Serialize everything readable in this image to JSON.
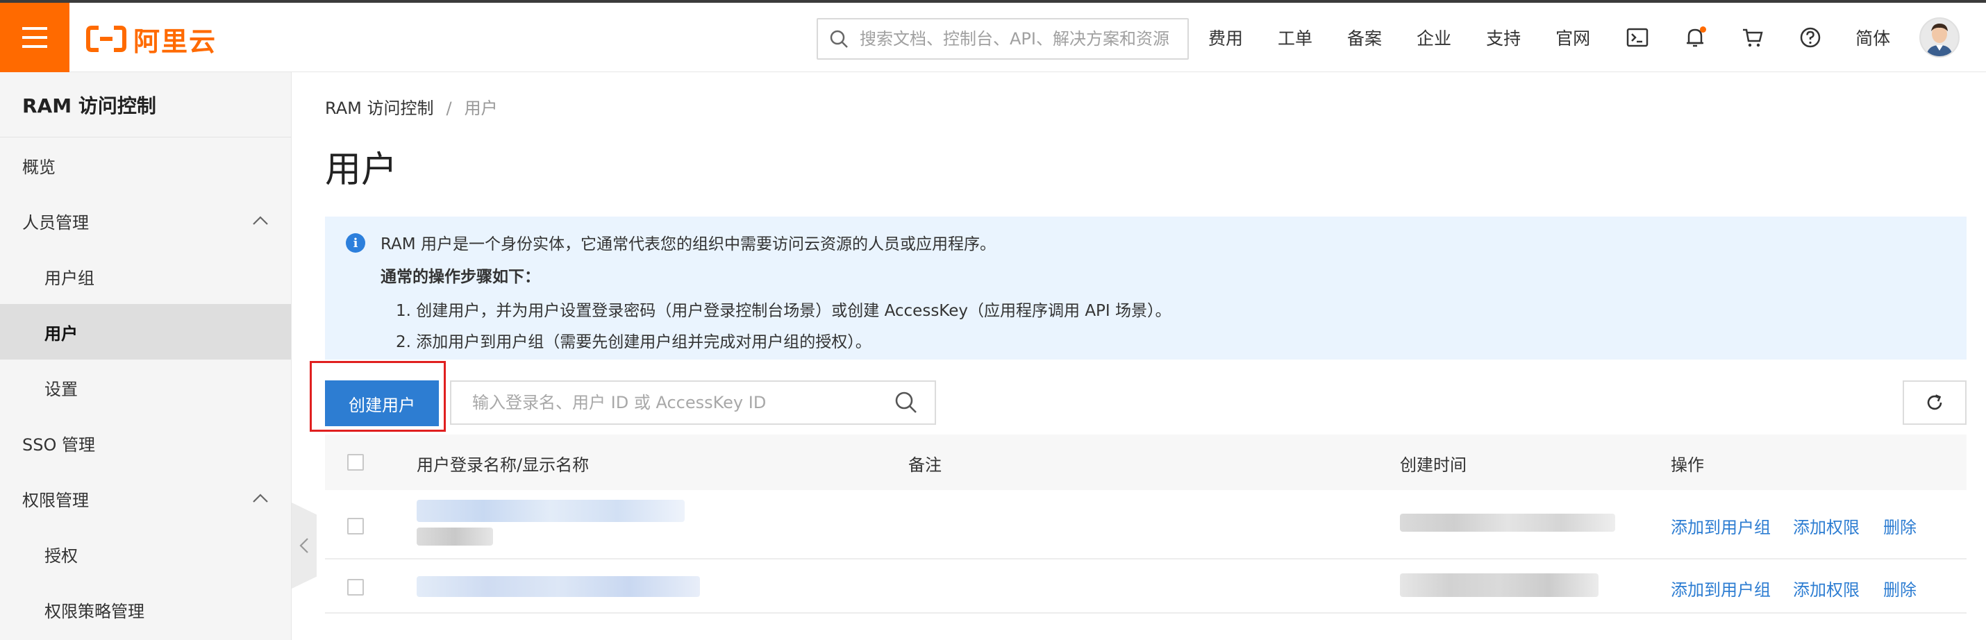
{
  "topbar": {
    "logo_text": "阿里云",
    "search_placeholder": "搜索文档、控制台、API、解决方案和资源",
    "nav": [
      "费用",
      "工单",
      "备案",
      "企业",
      "支持",
      "官网"
    ],
    "lang": "简体"
  },
  "sidebar": {
    "title": "RAM 访问控制",
    "items": [
      {
        "label": "概览"
      },
      {
        "label": "人员管理"
      },
      {
        "label": "用户组"
      },
      {
        "label": "用户"
      },
      {
        "label": "设置"
      },
      {
        "label": "SSO 管理"
      },
      {
        "label": "权限管理"
      },
      {
        "label": "授权"
      },
      {
        "label": "权限策略管理"
      }
    ]
  },
  "breadcrumb": {
    "root": "RAM 访问控制",
    "sep": "/",
    "current": "用户"
  },
  "page_title": "用户",
  "info": {
    "line1": "RAM 用户是一个身份实体，它通常代表您的组织中需要访问云资源的人员或应用程序。",
    "line2": "通常的操作步骤如下：",
    "line3": "1. 创建用户，并为用户设置登录密码（用户登录控制台场景）或创建 AccessKey（应用程序调用 API 场景）。",
    "line4": "2. 添加用户到用户组（需要先创建用户组并完成对用户组的授权）。"
  },
  "toolbar": {
    "create_label": "创建用户",
    "filter_placeholder": "输入登录名、用户 ID 或 AccessKey ID"
  },
  "table": {
    "headers": {
      "name": "用户登录名称/显示名称",
      "note": "备注",
      "time": "创建时间",
      "ops": "操作"
    },
    "ops": {
      "add_group": "添加到用户组",
      "add_perm": "添加权限",
      "delete": "删除"
    }
  },
  "colors": {
    "brand": "#ff6a00",
    "primary": "#2d7dd2",
    "highlight": "#e02020",
    "info_bg": "#eaf4fe"
  },
  "icons": [
    "menu-icon",
    "search-icon",
    "terminal-icon",
    "bell-icon",
    "cart-icon",
    "help-icon",
    "chevron-up-icon",
    "chevron-left-icon",
    "info-icon",
    "refresh-icon"
  ]
}
